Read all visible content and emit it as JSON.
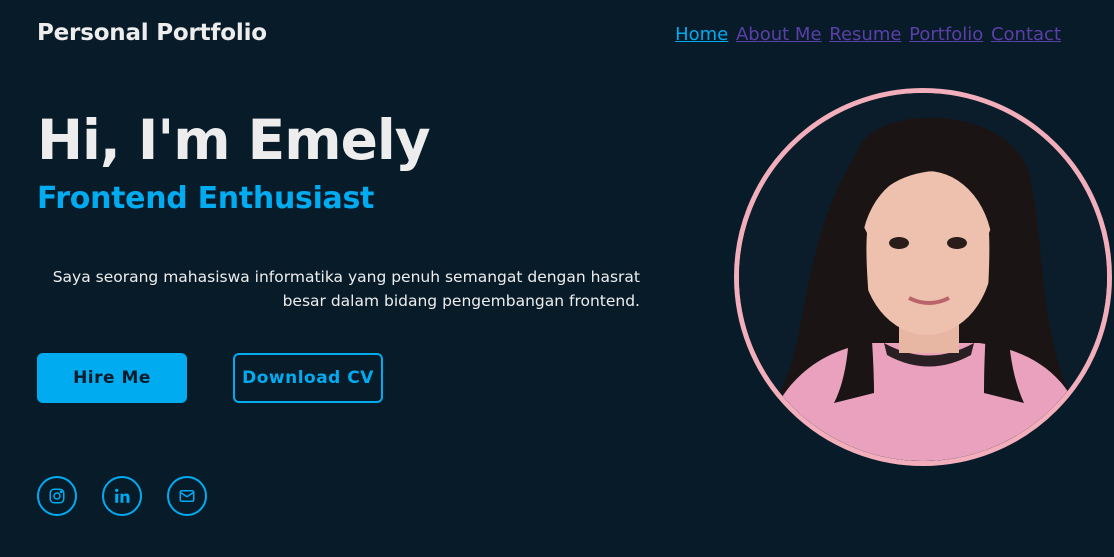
{
  "header": {
    "logo": "Personal Portfolio",
    "nav": [
      "Home",
      "About Me",
      "Resume",
      "Portfolio",
      "Contact"
    ]
  },
  "hero": {
    "title": "Hi, I'm Emely",
    "subtitle": "Frontend Enthusiast",
    "description": "Saya seorang mahasiswa informatika yang penuh semangat dengan hasrat besar dalam bidang pengembangan frontend.",
    "hire_label": "Hire Me",
    "cv_label": "Download CV"
  },
  "social": [
    "instagram-icon",
    "linkedin-icon",
    "mail-icon"
  ],
  "colors": {
    "background": "#081b29",
    "accent": "#00abf0",
    "text": "#ededed",
    "nav_link": "#5a3fa8",
    "photo_border": "#f2aebb"
  }
}
